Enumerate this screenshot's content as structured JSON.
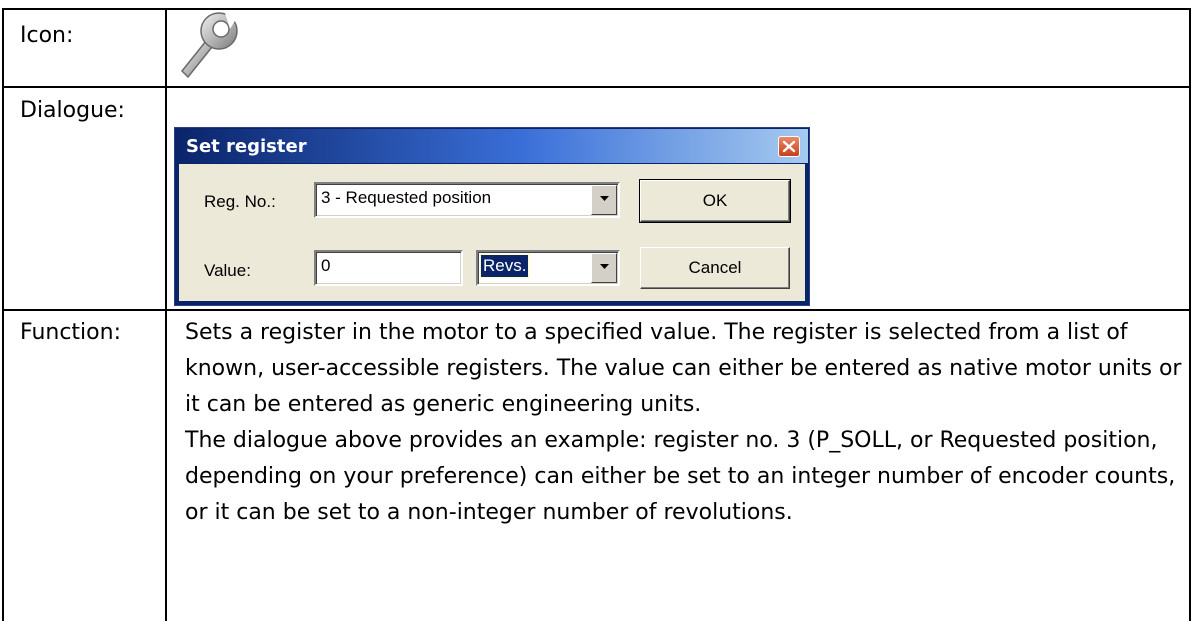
{
  "table": {
    "rows": [
      {
        "label": "Icon:"
      },
      {
        "label": "Dialogue:"
      },
      {
        "label": "Function:"
      }
    ]
  },
  "icon": {
    "name": "wrench-icon"
  },
  "dialog": {
    "title": "Set register",
    "close_icon": "close-icon",
    "reg_no_label": "Reg. No.:",
    "reg_no_value": "3 - Requested position",
    "value_label": "Value:",
    "value_input": "0",
    "unit_value": "Revs.",
    "ok_label": "OK",
    "cancel_label": "Cancel",
    "colors": {
      "title_start": "#0a246a",
      "title_end": "#a6caf0",
      "body": "#ece9d8",
      "close": "#c8401a"
    }
  },
  "function": {
    "paragraph1": "Sets a register in the motor to a specified value. The register is selected from a list of known, user-accessible registers. The value can either be entered as native motor units or it can be entered as generic engineering units.",
    "paragraph2": "The dialogue above provides an example: register no. 3 (P_SOLL, or Requested position, depending on your preference) can either be set to an integer number of encoder counts, or it can be set to a non-integer number of revolutions."
  }
}
